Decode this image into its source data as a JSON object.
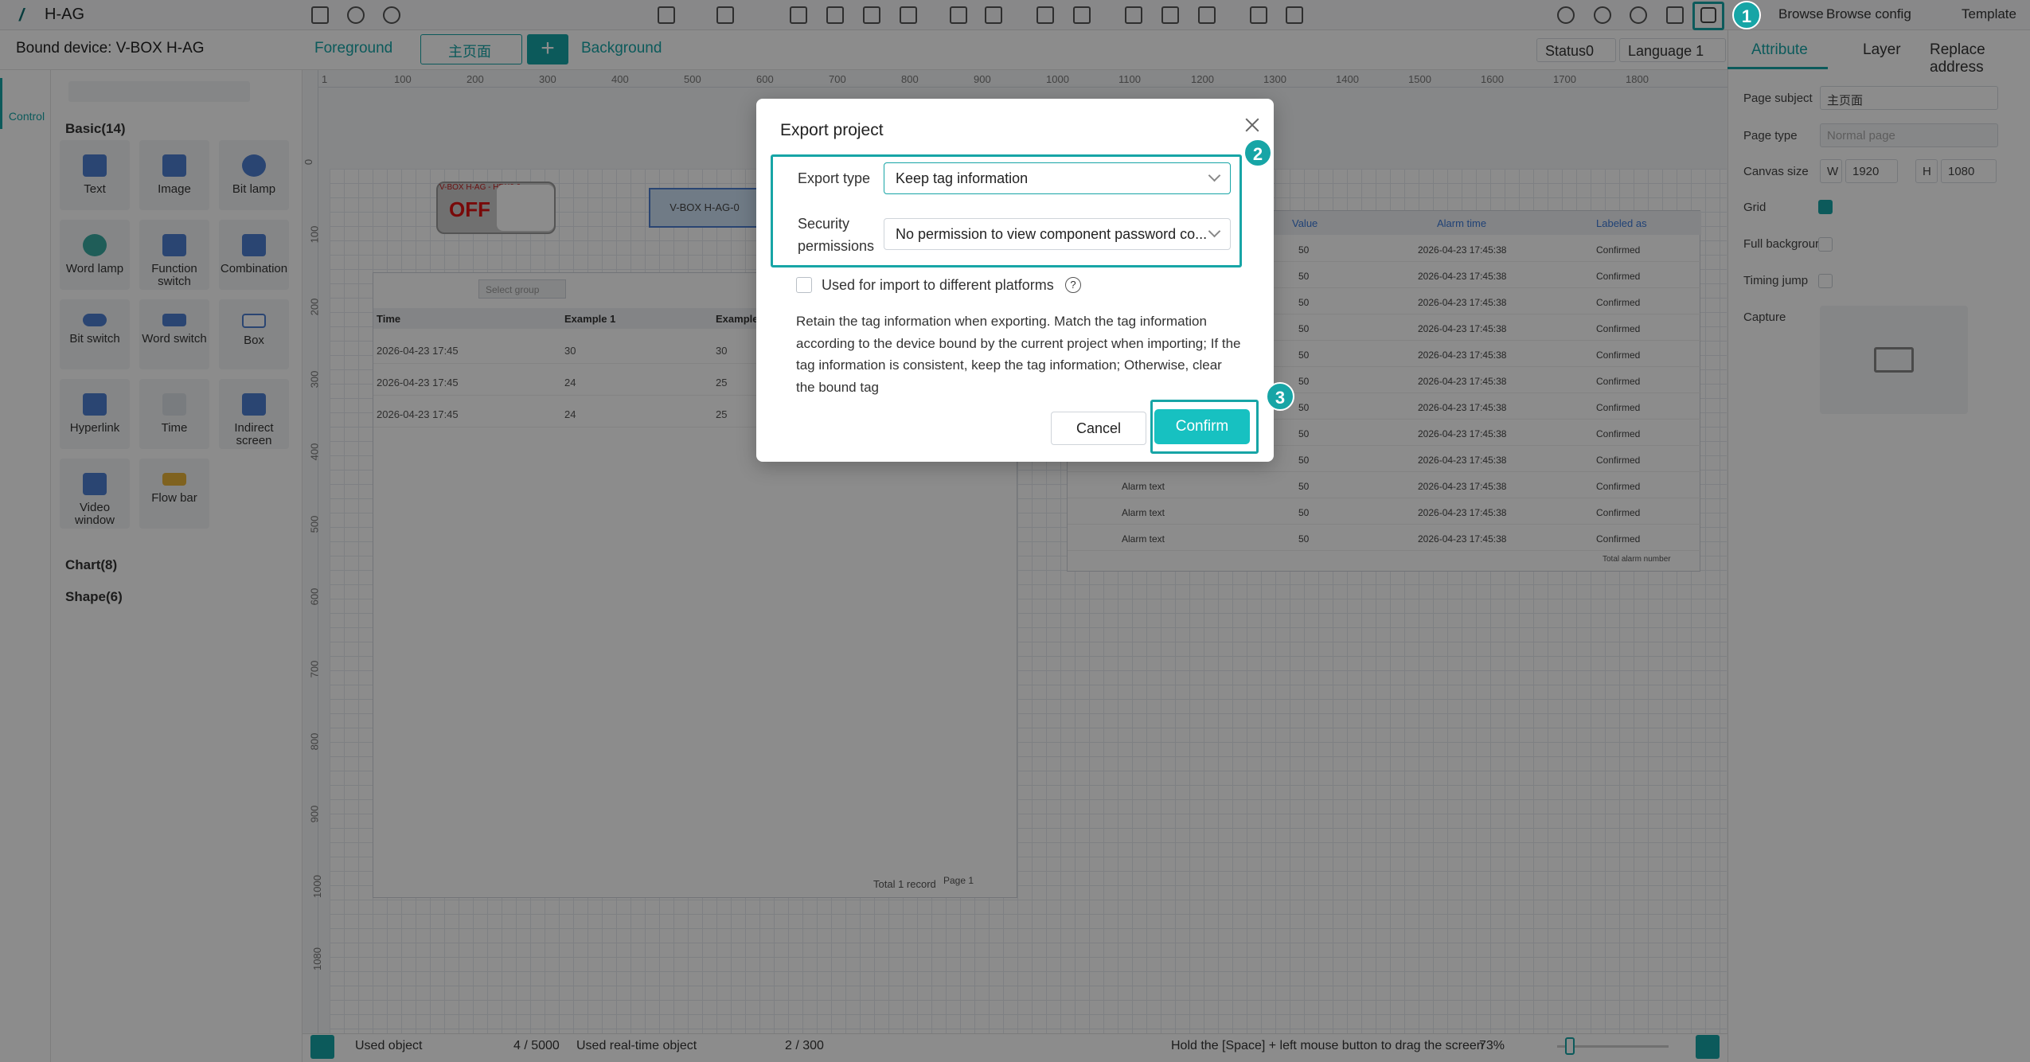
{
  "app": {
    "name": "H-AG",
    "bound_device": "Bound device: V-BOX H-AG"
  },
  "toolbar": {
    "browse": "Browse",
    "browse_config": "Browse config",
    "template": "Template"
  },
  "pagebar": {
    "foreground": "Foreground",
    "page_name": "主页面",
    "background": "Background",
    "status": "Status0",
    "language": "Language 1"
  },
  "right_panel": {
    "tabs": [
      "Attribute",
      "Layer",
      "Replace address"
    ],
    "page_subject_label": "Page subject",
    "page_subject": "主页面",
    "page_type_label": "Page type",
    "page_type": "Normal page",
    "canvas_size_label": "Canvas size",
    "w_label": "W",
    "w": "1920",
    "h_label": "H",
    "h": "1080",
    "grid_label": "Grid",
    "full_bg_label": "Full backgrour",
    "timing_jump_label": "Timing jump",
    "capture_label": "Capture"
  },
  "left_panel": {
    "rail_label": "Control",
    "basic_header": "Basic(14)",
    "controls": [
      "Text",
      "Image",
      "Bit lamp",
      "Word lamp",
      "Function switch",
      "Combination",
      "Bit switch",
      "Word switch",
      "Box",
      "Hyperlink",
      "Time",
      "Indirect screen",
      "Video window",
      "Flow bar"
    ],
    "chart_header": "Chart(8)",
    "shape_header": "Shape(6)"
  },
  "rulers": {
    "h": [
      "1",
      "100",
      "200",
      "300",
      "400",
      "500",
      "600",
      "700",
      "800",
      "900",
      "1000",
      "1100",
      "1200",
      "1300",
      "1400",
      "1500",
      "1600",
      "1700",
      "1800"
    ],
    "v": [
      "0",
      "100",
      "200",
      "300",
      "400",
      "500",
      "600",
      "700",
      "800",
      "900",
      "1000",
      "1080"
    ]
  },
  "canvas": {
    "lamp_label": "V-BOX H-AG - HDX0 0",
    "lamp_text": "OFF",
    "word_widget": "V-BOX H-AG-0",
    "select_group": "Select group",
    "table_headers": [
      "Time",
      "Example 1",
      "Example"
    ],
    "table_rows": [
      [
        "2026-04-23 17:45",
        "30",
        "30"
      ],
      [
        "2026-04-23 17:45",
        "24",
        "25"
      ],
      [
        "2026-04-23 17:45",
        "24",
        "25"
      ]
    ],
    "table_footer": "Total 1 record",
    "table_page": "Page 1",
    "alarm_headers": [
      "Value",
      "Alarm time",
      "Labeled as"
    ],
    "alarm_rows": [
      {
        "text": "",
        "value": "50",
        "time": "2026-04-23 17:45:38",
        "label": "Confirmed"
      },
      {
        "text": "",
        "value": "50",
        "time": "2026-04-23 17:45:38",
        "label": "Confirmed"
      },
      {
        "text": "",
        "value": "50",
        "time": "2026-04-23 17:45:38",
        "label": "Confirmed"
      },
      {
        "text": "",
        "value": "50",
        "time": "2026-04-23 17:45:38",
        "label": "Confirmed"
      },
      {
        "text": "",
        "value": "50",
        "time": "2026-04-23 17:45:38",
        "label": "Confirmed"
      },
      {
        "text": "",
        "value": "50",
        "time": "2026-04-23 17:45:38",
        "label": "Confirmed"
      },
      {
        "text": "",
        "value": "50",
        "time": "2026-04-23 17:45:38",
        "label": "Confirmed"
      },
      {
        "text": "",
        "value": "50",
        "time": "2026-04-23 17:45:38",
        "label": "Confirmed"
      },
      {
        "text": "",
        "value": "50",
        "time": "2026-04-23 17:45:38",
        "label": "Confirmed"
      },
      {
        "text": "Alarm text",
        "value": "50",
        "time": "2026-04-23 17:45:38",
        "label": "Confirmed"
      },
      {
        "text": "Alarm text",
        "value": "50",
        "time": "2026-04-23 17:45:38",
        "label": "Confirmed"
      },
      {
        "text": "Alarm text",
        "value": "50",
        "time": "2026-04-23 17:45:38",
        "label": "Confirmed"
      }
    ],
    "alarm_footer": "Total alarm number"
  },
  "bottom": {
    "used_object": "Used object",
    "used_object_count": "4 / 5000",
    "used_realtime": "Used real-time object",
    "used_realtime_count": "2 / 300",
    "hint": "Hold the [Space] + left mouse button to drag the screen",
    "zoom": "73%"
  },
  "dialog": {
    "title": "Export project",
    "export_type_label": "Export type",
    "export_type_value": "Keep tag information",
    "security_label_1": "Security",
    "security_label_2": "permissions",
    "security_value": "No permission to view component password co...",
    "import_checkbox_label": "Used for import to different platforms",
    "description": "Retain the tag information when exporting. Match the tag information according to the device bound by the current project when importing; If the tag information is consistent, keep the tag information; Otherwise, clear the bound tag",
    "cancel": "Cancel",
    "confirm": "Confirm"
  },
  "steps": [
    "1",
    "2",
    "3"
  ],
  "colors": {
    "accent": "#17a5a6",
    "confirm": "#17c1c1"
  }
}
